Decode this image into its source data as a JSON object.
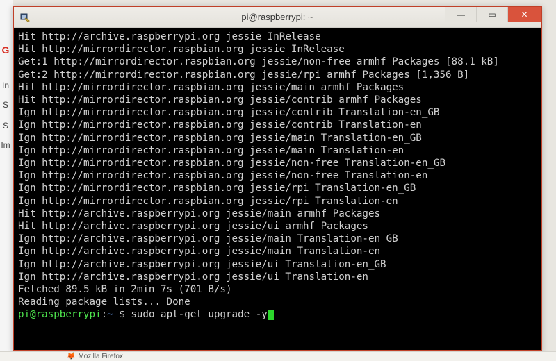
{
  "bg_hints": {
    "g": "G",
    "in": "In",
    "s1": "S",
    "s2": "S",
    "im": "Im"
  },
  "window": {
    "title": "pi@raspberrypi: ~",
    "controls": {
      "min": "—",
      "max": "▭",
      "close": "✕"
    }
  },
  "terminal": {
    "lines": [
      "Hit http://archive.raspberrypi.org jessie InRelease",
      "Hit http://mirrordirector.raspbian.org jessie InRelease",
      "Get:1 http://mirrordirector.raspbian.org jessie/non-free armhf Packages [88.1 kB]",
      "Get:2 http://mirrordirector.raspbian.org jessie/rpi armhf Packages [1,356 B]",
      "Hit http://mirrordirector.raspbian.org jessie/main armhf Packages",
      "Hit http://mirrordirector.raspbian.org jessie/contrib armhf Packages",
      "Ign http://mirrordirector.raspbian.org jessie/contrib Translation-en_GB",
      "Ign http://mirrordirector.raspbian.org jessie/contrib Translation-en",
      "Ign http://mirrordirector.raspbian.org jessie/main Translation-en_GB",
      "Ign http://mirrordirector.raspbian.org jessie/main Translation-en",
      "Ign http://mirrordirector.raspbian.org jessie/non-free Translation-en_GB",
      "Ign http://mirrordirector.raspbian.org jessie/non-free Translation-en",
      "Ign http://mirrordirector.raspbian.org jessie/rpi Translation-en_GB",
      "Ign http://mirrordirector.raspbian.org jessie/rpi Translation-en",
      "Hit http://archive.raspberrypi.org jessie/main armhf Packages",
      "Hit http://archive.raspberrypi.org jessie/ui armhf Packages",
      "Ign http://archive.raspberrypi.org jessie/main Translation-en_GB",
      "Ign http://archive.raspberrypi.org jessie/main Translation-en",
      "Ign http://archive.raspberrypi.org jessie/ui Translation-en_GB",
      "Ign http://archive.raspberrypi.org jessie/ui Translation-en",
      "Fetched 89.5 kB in 2min 7s (701 B/s)",
      "Reading package lists... Done"
    ],
    "prompt": {
      "user": "pi",
      "host": "raspberrypi",
      "path": "~",
      "dollar": "$",
      "command": "sudo apt-get upgrade -y"
    }
  },
  "taskbar": {
    "firefox_label": "Mozilla Firefox"
  }
}
